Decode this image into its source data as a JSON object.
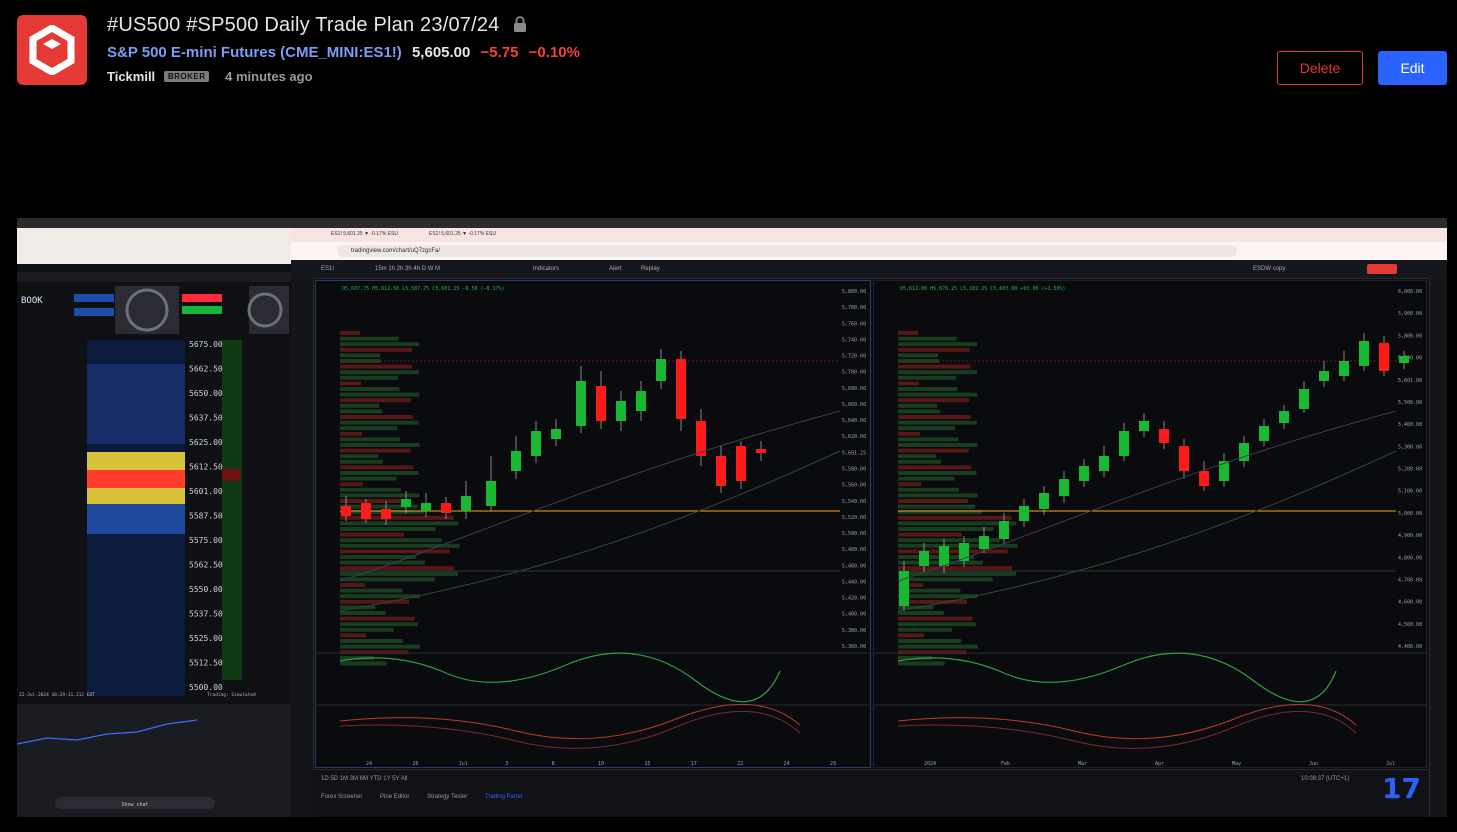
{
  "header": {
    "title": "#US500 #SP500 Daily Trade Plan 23/07/24",
    "symbol_name": "S&P 500 E-mini Futures",
    "symbol_code": "(CME_MINI:ES1!)",
    "price": "5,605.00",
    "change": "−5.75",
    "change_pct": "−0.10%",
    "author": "Tickmill",
    "author_badge": "BROKER",
    "time_ago": "4 minutes ago",
    "delete_label": "Delete",
    "edit_label": "Edit"
  },
  "colors": {
    "brand": "#e53935",
    "accent": "#2962ff",
    "up": "#26a69a",
    "down": "#f44336",
    "candle_up": "#19b833",
    "candle_down": "#ff1a1a"
  },
  "screenshot": {
    "url": "tradingview.com/chart/uQ7zgcFa/",
    "tab1": "ES1! 5,601.25 ▼ -0.17% ESU",
    "tab2": "ES1! 5,601.25 ▼ -0.17% ESU",
    "ticker": "ES1!",
    "intervals": "15m 1h 2h 3h 4h D W M",
    "indicators_label": "Indicators",
    "alert_label": "Alert",
    "replay_label": "Replay",
    "layout_name": "ESDW copy",
    "bottom_ranges": "1D 5D 1M 3M 6M YTD 1Y 5Y All",
    "bottom_tabs": [
      "Forex Screener",
      "Pine Editor",
      "Strategy Tester",
      "Trading Panel"
    ],
    "clock": "10:08:37 (UTC+1)",
    "left_book_label": "BOOK",
    "left_prices": [
      "5675.00",
      "5662.50",
      "5650.00",
      "5637.50",
      "5625.00",
      "5612.50",
      "5601.00",
      "5587.50",
      "5575.00",
      "5562.50",
      "5550.00",
      "5537.50",
      "5525.00",
      "5512.50",
      "5500.00"
    ],
    "left_footer": "22-Jul-2024 16:29:11.112 EDT",
    "left_status": "Trading: Simulated",
    "chat_label": "Show chat",
    "paneA_axis": [
      "5,800.00",
      "5,780.00",
      "5,760.00",
      "5,740.00",
      "5,720.00",
      "5,700.00",
      "5,680.00",
      "5,660.00",
      "5,640.00",
      "5,620.00",
      "5,601.25",
      "5,580.00",
      "5,560.00",
      "5,540.00",
      "5,520.00",
      "5,500.00",
      "5,480.00",
      "5,460.00",
      "5,440.00",
      "5,420.00",
      "5,400.00",
      "5,380.00",
      "5,360.00"
    ],
    "paneB_axis": [
      "6,000.00",
      "5,900.00",
      "5,800.00",
      "5,700.00",
      "5,601.00",
      "5,500.00",
      "5,400.00",
      "5,300.00",
      "5,200.00",
      "5,100.00",
      "5,000.00",
      "4,900.00",
      "4,800.00",
      "4,700.00",
      "4,600.00",
      "4,500.00",
      "4,400.00"
    ],
    "paneA_dates": [
      "24",
      "26",
      "Jul",
      "3",
      "8",
      "10",
      "15",
      "17",
      "22",
      "24",
      "29"
    ],
    "paneB_dates": [
      "2024",
      "Feb",
      "Mar",
      "Apr",
      "May",
      "Jun",
      "Jul"
    ],
    "paneA_ohlc": "O5,607.75 H5,612.50 L5,587.75 C5,601.25 −9.50 (−0.17%)",
    "paneB_ohlc": "O5,612.00 H5,676.25 L5,182.25 C5,603.00 +93.00 (+1.50%)"
  }
}
